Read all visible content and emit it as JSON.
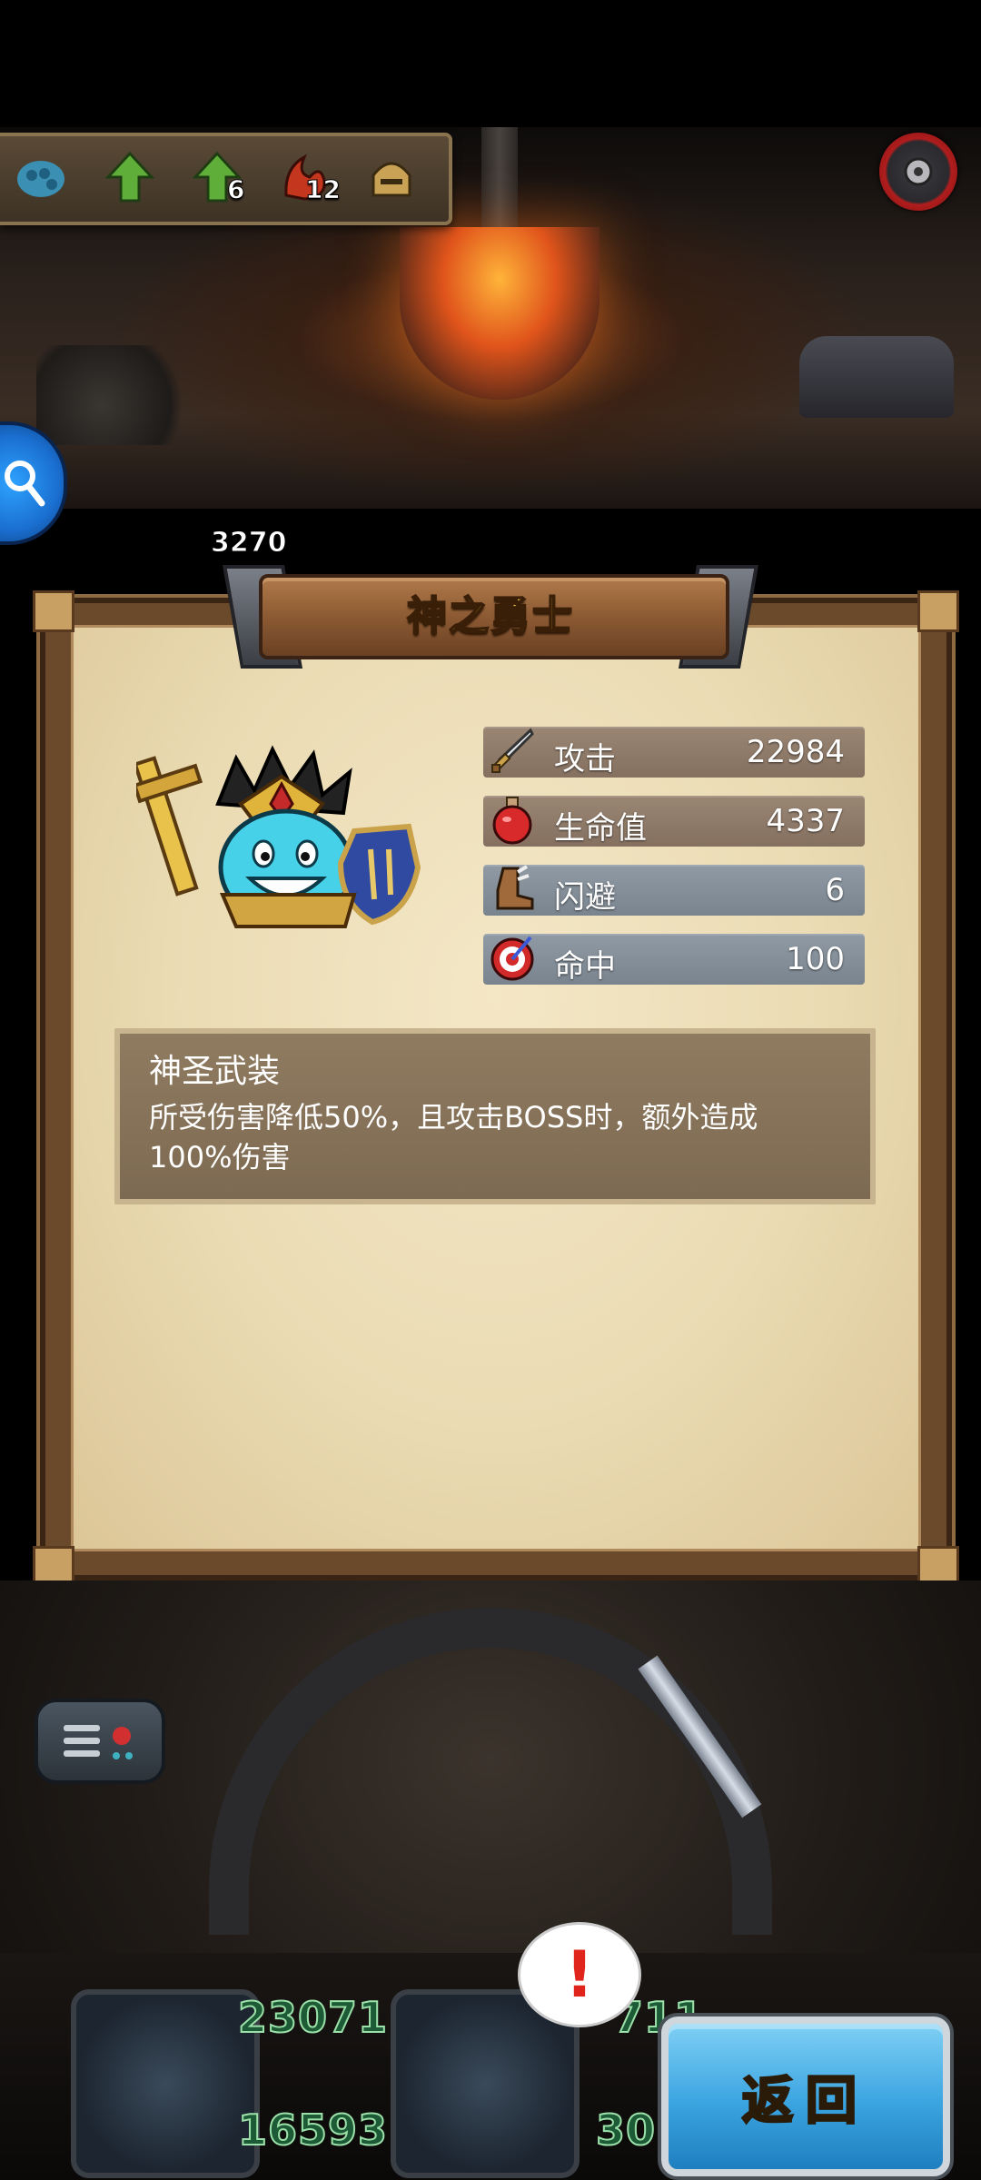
{
  "topbar": {
    "items": [
      {
        "icon": "dragon-scale-icon",
        "count": ""
      },
      {
        "icon": "green-arrow-up-icon",
        "count": ""
      },
      {
        "icon": "green-arrow-up-icon",
        "count": "6"
      },
      {
        "icon": "fire-claw-icon",
        "count": "12"
      },
      {
        "icon": "golden-helmet-icon",
        "count": ""
      }
    ]
  },
  "score_chip": {
    "value": "3270"
  },
  "panel": {
    "title": "神之勇士",
    "stats": [
      {
        "icon": "sword-icon",
        "label": "攻击",
        "value": "22984"
      },
      {
        "icon": "potion-icon",
        "label": "生命值",
        "value": "4337"
      },
      {
        "icon": "boot-icon",
        "label": "闪避",
        "value": "6"
      },
      {
        "icon": "target-icon",
        "label": "命中",
        "value": "100"
      }
    ],
    "skill": {
      "name": "神圣武装",
      "description": "所受伤害降低50%，且攻击BOSS时，额外造成100%伤害"
    }
  },
  "bottom": {
    "num1": "23071",
    "num2": "16593",
    "num3": "711",
    "num4": "30",
    "alert": "!",
    "return_label": "返回"
  },
  "colors": {
    "title_gold": "#ffd24a",
    "stat_bg": "#8f7b68",
    "return_blue": "#3aa4e0",
    "parchment": "#eadbb3"
  }
}
